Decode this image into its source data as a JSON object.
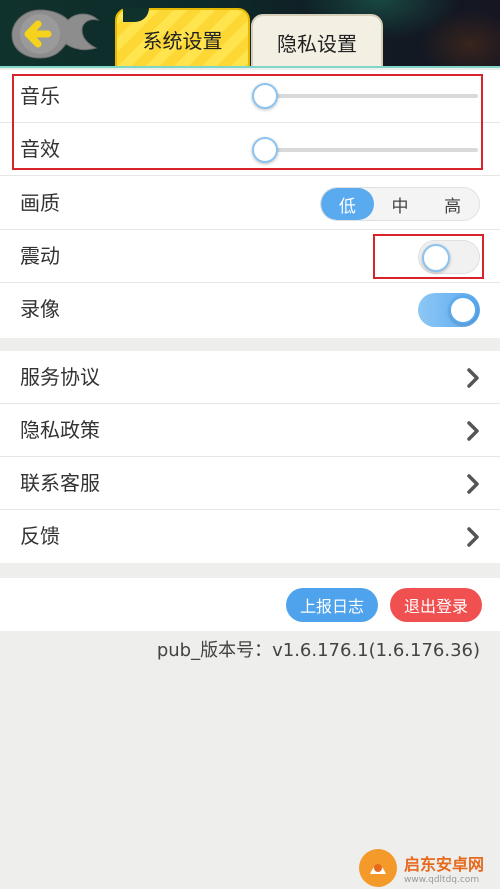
{
  "tabs": [
    {
      "label": "系统设置",
      "active": true
    },
    {
      "label": "隐私设置",
      "active": false
    }
  ],
  "settings": {
    "music": {
      "label": "音乐",
      "level": 0
    },
    "sound": {
      "label": "音效",
      "level": 0
    },
    "quality": {
      "label": "画质",
      "options": [
        "低",
        "中",
        "高"
      ],
      "selected": "低"
    },
    "vibration": {
      "label": "震动",
      "on": false
    },
    "record": {
      "label": "录像",
      "on": true
    }
  },
  "links": [
    {
      "label": "服务协议"
    },
    {
      "label": "隐私政策"
    },
    {
      "label": "联系客服"
    },
    {
      "label": "反馈"
    }
  ],
  "buttons": {
    "report_log": "上报日志",
    "logout": "退出登录"
  },
  "version": "pub_版本号：v1.6.176.1(1.6.176.36)",
  "watermark": {
    "name": "启东安卓网",
    "url": "www.qdltdq.com"
  },
  "colors": {
    "accent_blue": "#5aaaf0",
    "logout_red": "#f0504f",
    "highlight_red": "#d9232a",
    "tab_yellow": "#fdd835"
  },
  "icons": {
    "back": "back-arrow-icon",
    "chevron": "chevron-right-icon"
  }
}
